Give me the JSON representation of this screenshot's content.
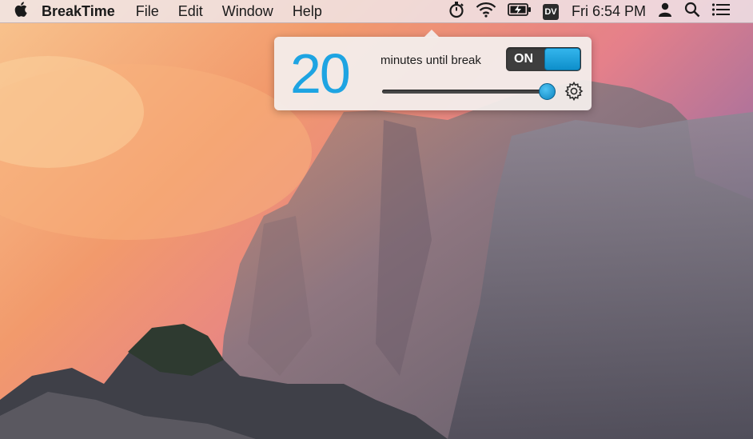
{
  "menubar": {
    "apple_icon": "apple-logo-icon",
    "app_name": "BreakTime",
    "menus": [
      "File",
      "Edit",
      "Window",
      "Help"
    ],
    "status": {
      "timer_icon": "stopwatch-icon",
      "wifi_icon": "wifi-icon",
      "battery_icon": "battery-charging-icon",
      "dv_badge": "DV",
      "clock": "Fri 6:54 PM",
      "user_icon": "user-silhouette-icon",
      "search_icon": "spotlight-search-icon",
      "list_icon": "notification-center-icon"
    }
  },
  "popover": {
    "minutes_value": "20",
    "minutes_label": "minutes until break",
    "toggle_label": "ON",
    "toggle_state": "on",
    "slider_value_fraction": 0.95,
    "settings_icon": "gear-icon",
    "accent_color": "#1ea4e2"
  }
}
